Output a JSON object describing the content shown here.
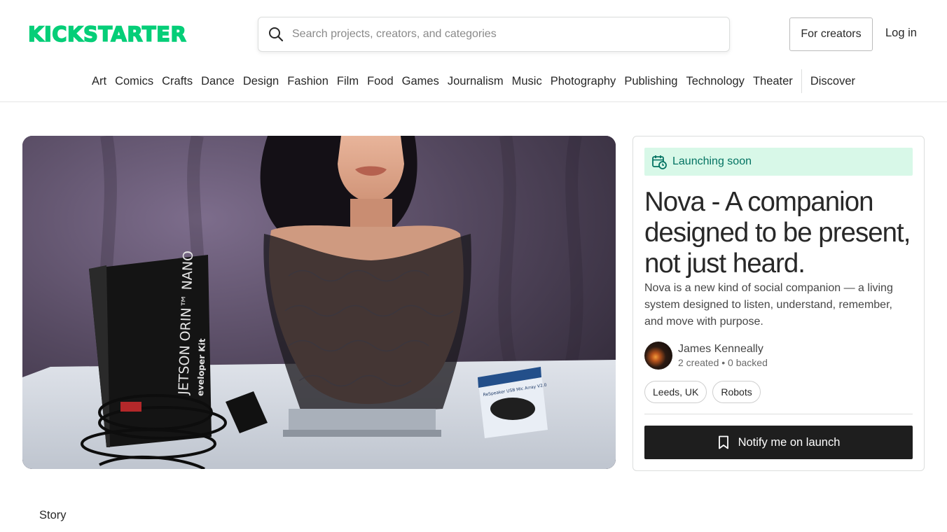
{
  "header": {
    "logo_text": "KICKSTARTER",
    "search_placeholder": "Search projects, creators, and categories",
    "for_creators_label": "For creators",
    "login_label": "Log in"
  },
  "categories": [
    "Art",
    "Comics",
    "Crafts",
    "Dance",
    "Design",
    "Fashion",
    "Film",
    "Food",
    "Games",
    "Journalism",
    "Music",
    "Photography",
    "Publishing",
    "Technology",
    "Theater"
  ],
  "discover_label": "Discover",
  "hero": {
    "image_alt": "Nova project photo",
    "box_text": "JETSON ORIN™ NANO",
    "box_subtext": "eveloper Kit",
    "mic_box_text": "ReSpeaker USB Mic Array V2.0"
  },
  "project": {
    "status": "Launching soon",
    "title": "Nova - A companion designed to be present, not just heard.",
    "blurb": "Nova is a new kind of social companion — a living system designed to listen, understand, remember, and move with purpose.",
    "creator_name": "James Kenneally",
    "creator_meta": "2 created • 0 backed",
    "tags": [
      "Leeds, UK",
      "Robots"
    ],
    "notify_label": "Notify me on launch"
  },
  "tabs": {
    "story_label": "Story"
  },
  "colors": {
    "brand_green": "#05ce78",
    "badge_bg": "#d8f8e8",
    "badge_text": "#037362",
    "button_dark": "#1e1e1e"
  }
}
